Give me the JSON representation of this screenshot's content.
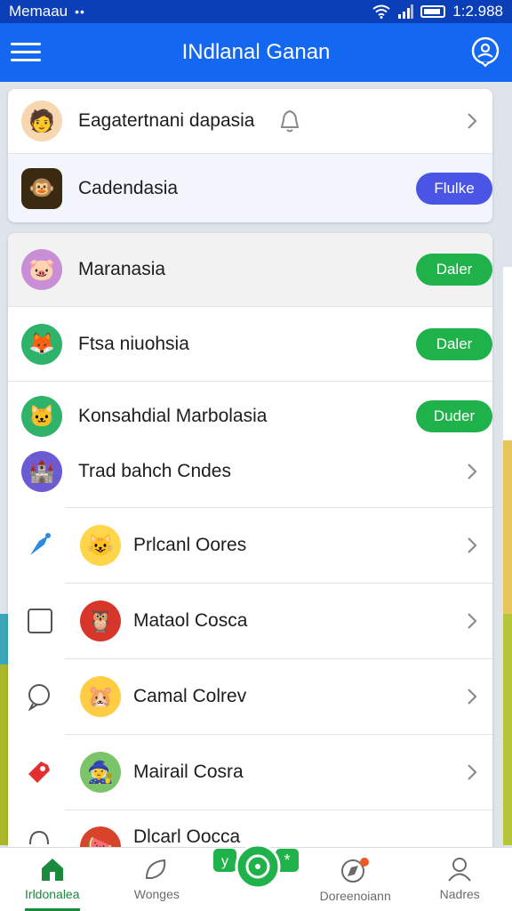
{
  "status_bar": {
    "carrier": "Memaau",
    "dots": "••",
    "time": "1:2.988"
  },
  "app_bar": {
    "title": "INdlanal Ganan"
  },
  "card_top": {
    "rows": [
      {
        "label": "Eagatertnani dapasia"
      },
      {
        "label": "Cadendasia",
        "button": "Flulke"
      }
    ]
  },
  "list": {
    "pill_rows": [
      {
        "label": "Maranasia",
        "button": "Daler"
      },
      {
        "label": "Ftsa niuohsia",
        "button": "Daler"
      },
      {
        "label": "Konsahdial Marbolasia",
        "button": "Duder"
      }
    ],
    "nav_rows": [
      {
        "label": "Trad bahch Cndes"
      },
      {
        "label": "Prlcanl Oores"
      },
      {
        "label": "Mataol Cosca"
      },
      {
        "label": "Camal Colrev"
      },
      {
        "label": "Mairail Cosra"
      },
      {
        "label": "Dlcarl Oocca"
      }
    ]
  },
  "bottom_nav": {
    "items": [
      {
        "label": "Irldonalea"
      },
      {
        "label": "Wonges"
      },
      {
        "label": "Doreenoiann"
      },
      {
        "label": "Nadres"
      }
    ]
  },
  "colors": {
    "status_bar": "#0a3fb8",
    "app_bar": "#1467f0",
    "green_button": "#1fb24a",
    "blue_button": "#4a55e6",
    "active_nav": "#1a8a3c"
  }
}
